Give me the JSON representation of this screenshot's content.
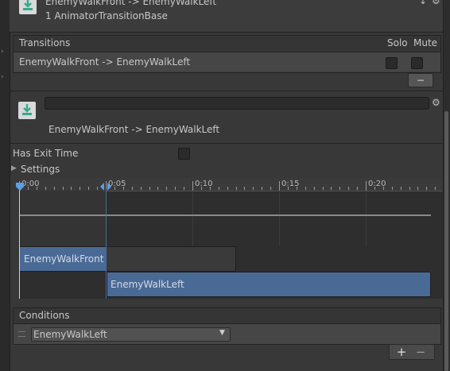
{
  "header": {
    "title": "EnemyWalkFront -> EnemyWalkLeft",
    "subtitle": "1 AnimatorTransitionBase",
    "icon": "animator-transition-icon"
  },
  "transitions": {
    "heading": "Transitions",
    "solo_label": "Solo",
    "mute_label": "Mute",
    "rows": [
      {
        "name": "EnemyWalkFront -> EnemyWalkLeft",
        "solo": false,
        "mute": false
      }
    ],
    "remove_label": "−"
  },
  "transition_detail": {
    "name_value": "",
    "label": "EnemyWalkFront -> EnemyWalkLeft"
  },
  "settings": {
    "has_exit_time_label": "Has Exit Time",
    "has_exit_time": false,
    "settings_label": "Settings"
  },
  "timeline": {
    "tick_labels": [
      "0:00",
      "0:05",
      "0:10",
      "0:15",
      "0:20"
    ],
    "source_clip": "EnemyWalkFront",
    "dest_clip": "EnemyWalkLeft"
  },
  "conditions": {
    "heading": "Conditions",
    "parameter": "EnemyWalkLeft",
    "add_label": "+",
    "remove_label": "−"
  },
  "colors": {
    "accent": "#4a6a96",
    "timeline_marker": "#5b9ee8",
    "icon_green": "#5fc2a4"
  }
}
